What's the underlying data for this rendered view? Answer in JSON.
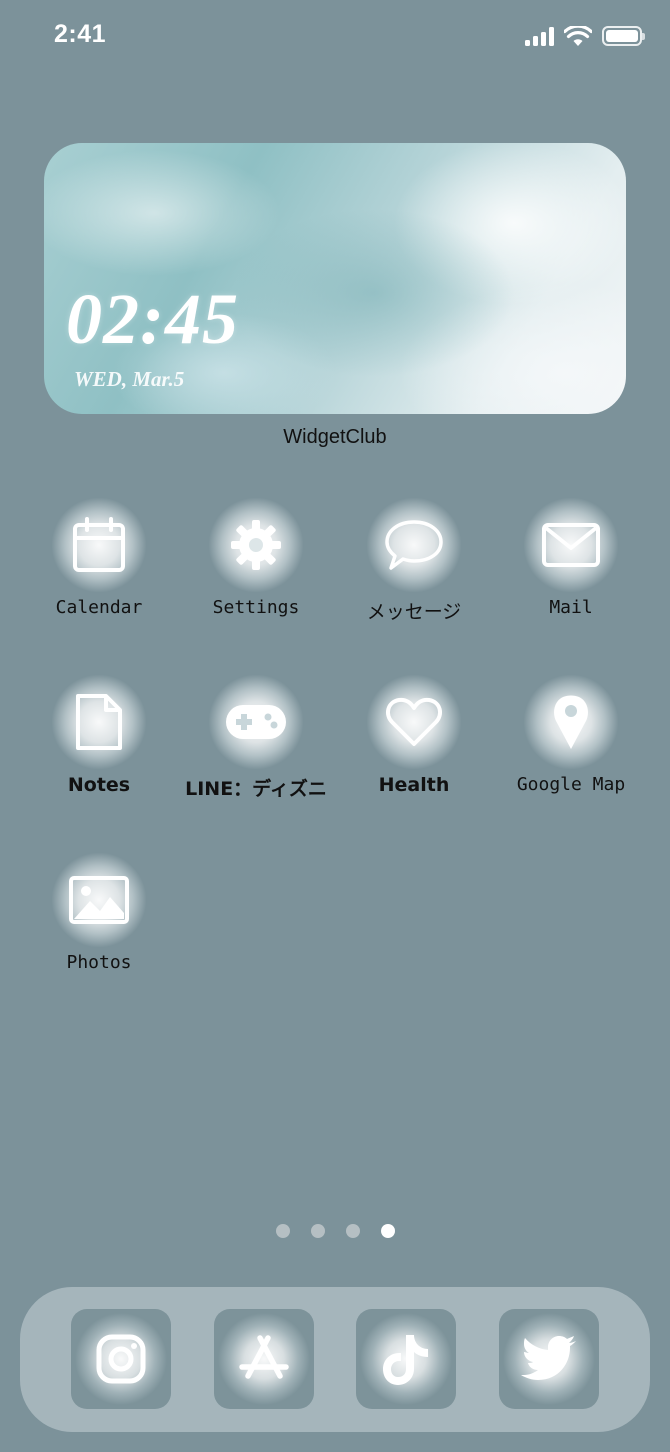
{
  "status_bar": {
    "time": "2:41",
    "icons": [
      "cellular-signal-icon",
      "wifi-icon",
      "battery-icon"
    ]
  },
  "widget": {
    "clock": "02:45",
    "date": "WED, Mar.5",
    "label": "WidgetClub"
  },
  "apps": [
    {
      "label": "Calendar",
      "icon": "calendar-icon"
    },
    {
      "label": "Settings",
      "icon": "gear-icon"
    },
    {
      "label": "メッセージ",
      "icon": "speech-bubble-icon"
    },
    {
      "label": "Mail",
      "icon": "envelope-icon"
    },
    {
      "label": "Notes",
      "icon": "document-icon"
    },
    {
      "label": "LINE：ディズニ",
      "icon": "gamepad-icon"
    },
    {
      "label": "Health",
      "icon": "heart-icon"
    },
    {
      "label": "Google Map",
      "icon": "map-pin-icon"
    },
    {
      "label": "Photos",
      "icon": "photo-icon"
    }
  ],
  "page_indicator": {
    "total": 4,
    "active": 4
  },
  "dock": [
    {
      "icon": "instagram-icon"
    },
    {
      "icon": "app-store-icon"
    },
    {
      "icon": "tiktok-icon"
    },
    {
      "icon": "twitter-icon"
    }
  ],
  "colors": {
    "background": "#7c929a",
    "label_text": "#111111"
  }
}
